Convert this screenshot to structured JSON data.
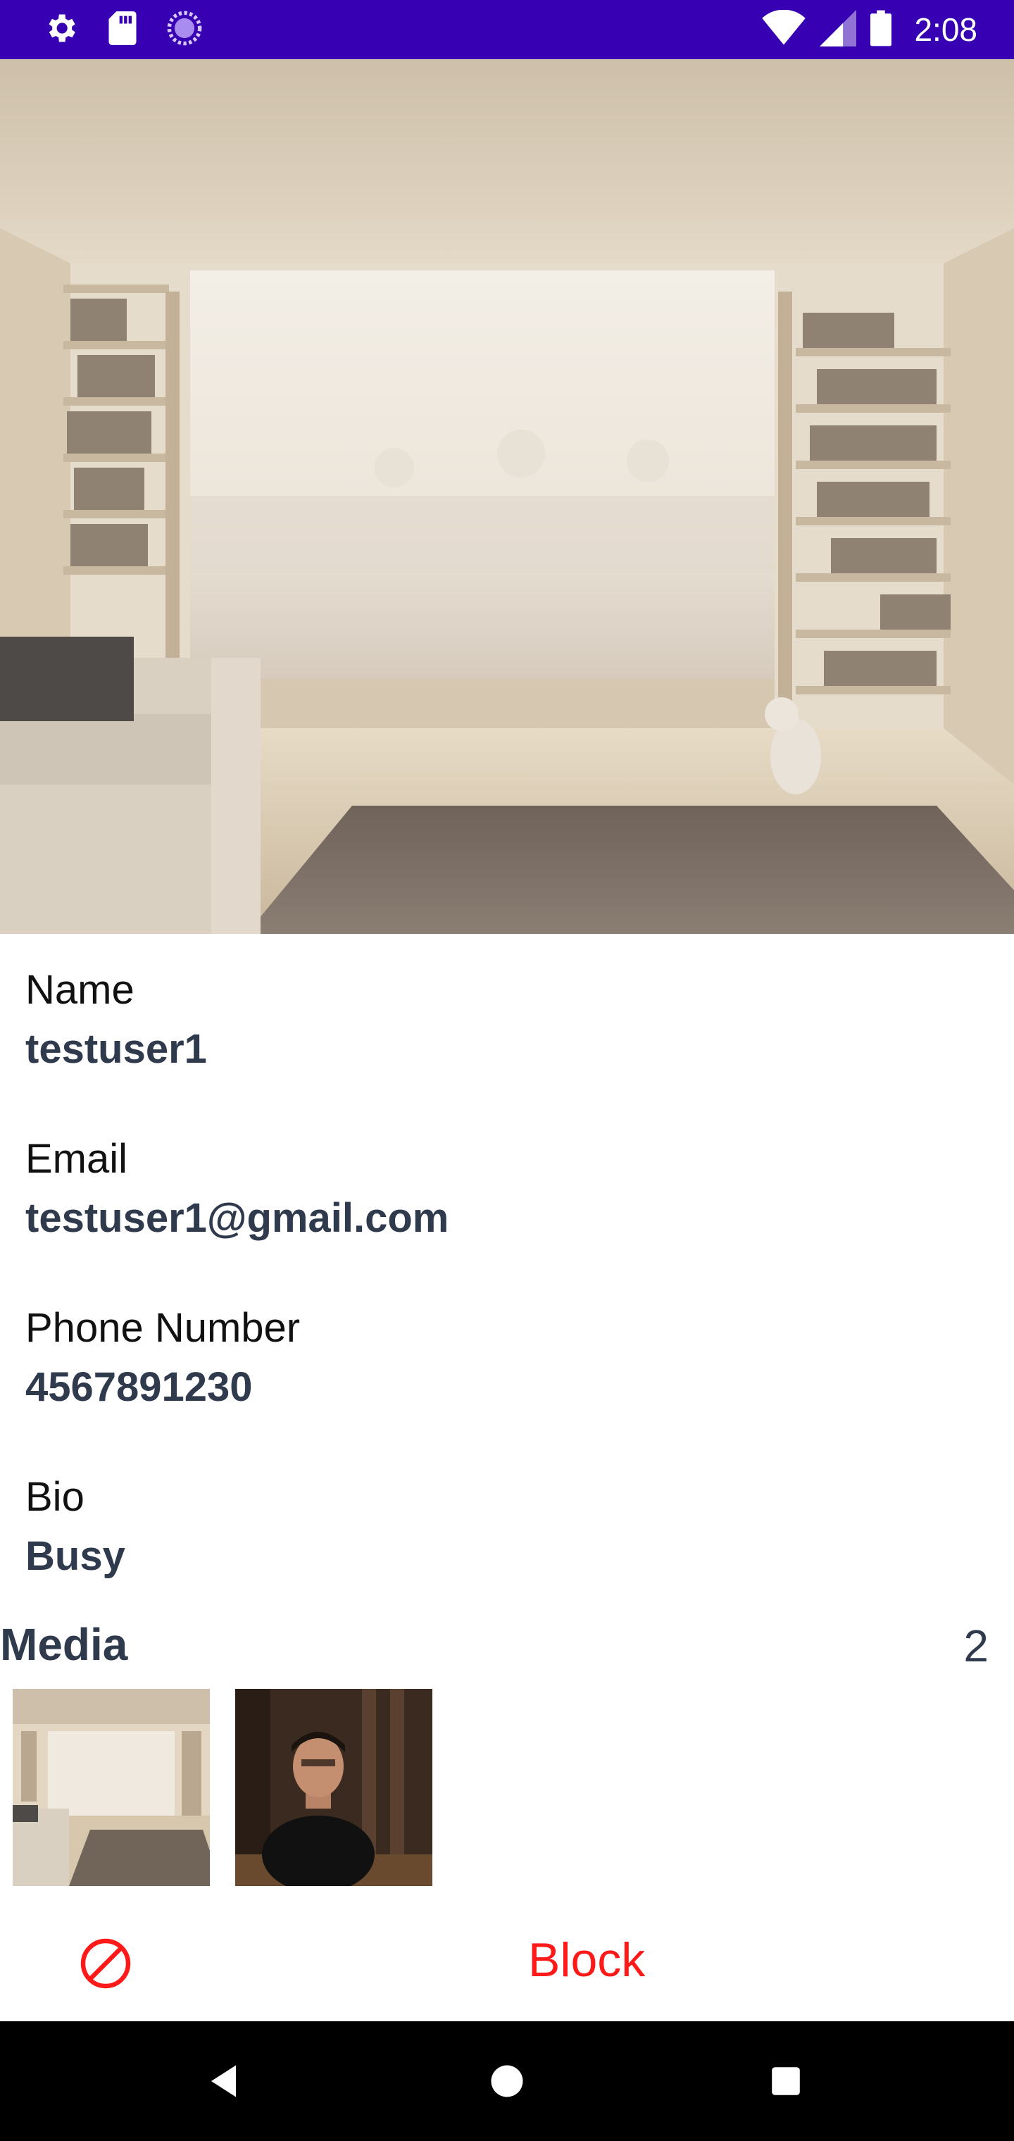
{
  "status_bar": {
    "time": "2:08",
    "icons": [
      "gear-icon",
      "sd-card-icon",
      "sync-icon",
      "wifi-icon",
      "cell-signal-icon",
      "battery-icon"
    ]
  },
  "profile": {
    "fields": [
      {
        "label": "Name",
        "value": "testuser1"
      },
      {
        "label": "Email",
        "value": "testuser1@gmail.com"
      },
      {
        "label": "Phone Number",
        "value": "4567891230"
      },
      {
        "label": "Bio",
        "value": "Busy"
      }
    ]
  },
  "media": {
    "title": "Media",
    "count": "2"
  },
  "block": {
    "label": "Block",
    "icon": "block-icon",
    "color": "#ff1a1a"
  },
  "nav": {
    "icons": [
      "back-icon",
      "home-icon",
      "recents-icon"
    ]
  },
  "colors": {
    "status_bar": "#3700b3",
    "value_text": "#2f3a4d",
    "nav_bar": "#000000"
  }
}
